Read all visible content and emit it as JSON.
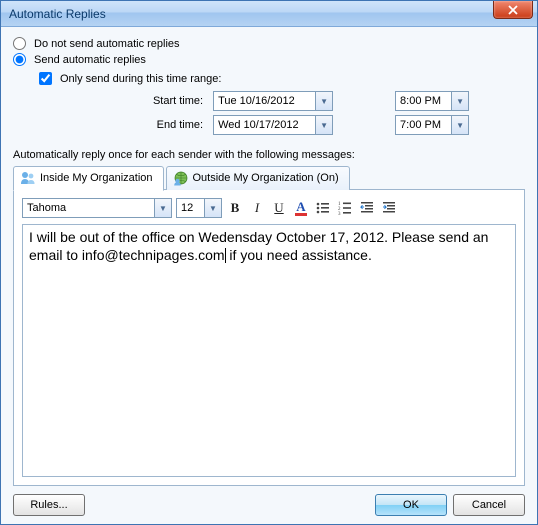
{
  "window": {
    "title": "Automatic Replies"
  },
  "options": {
    "do_not_send": "Do not send automatic replies",
    "send": "Send automatic replies",
    "only_range": "Only send during this time range:"
  },
  "time": {
    "start_label": "Start time:",
    "end_label": "End time:",
    "start_date": "Tue 10/16/2012",
    "start_time": "8:00 PM",
    "end_date": "Wed 10/17/2012",
    "end_time": "7:00 PM"
  },
  "section_label": "Automatically reply once for each sender with the following messages:",
  "tabs": {
    "inside": "Inside My Organization",
    "outside": "Outside My Organization (On)"
  },
  "toolbar": {
    "font": "Tahoma",
    "size": "12"
  },
  "message": {
    "part1": "I will be out of the office on Wedensday October 17, 2012. Please send an email to info@technipages.com",
    "part2": " if you need assistance."
  },
  "footer": {
    "rules": "Rules...",
    "ok": "OK",
    "cancel": "Cancel"
  }
}
